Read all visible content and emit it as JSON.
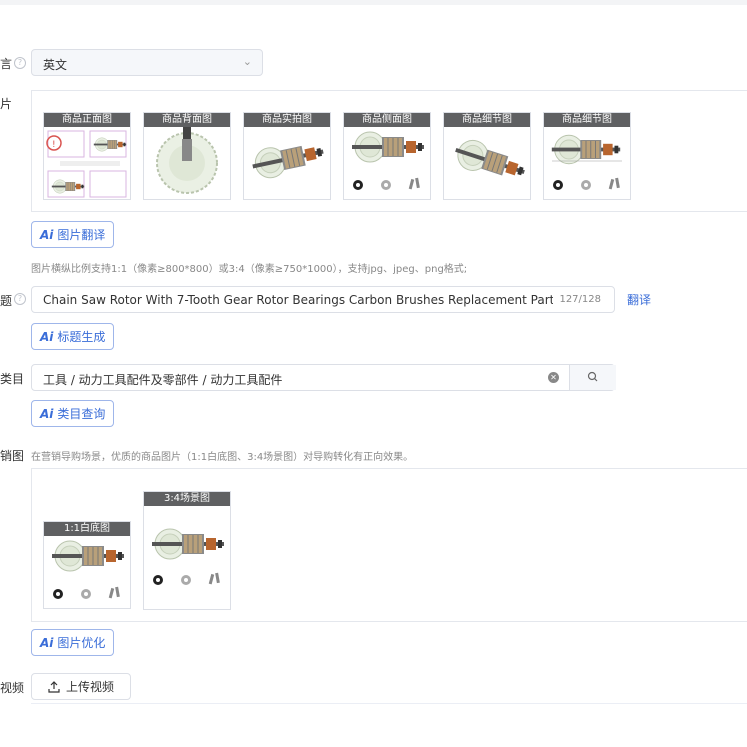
{
  "labels": {
    "language": "言",
    "images": "片",
    "title": "题",
    "category": "类目",
    "marketing": "销图",
    "video": "视频"
  },
  "language_select": {
    "value": "英文"
  },
  "product_images": [
    {
      "caption": "商品正面图"
    },
    {
      "caption": "商品背面图"
    },
    {
      "caption": "商品实拍图"
    },
    {
      "caption": "商品侧面图"
    },
    {
      "caption": "商品细节图"
    },
    {
      "caption": "商品细节图"
    }
  ],
  "buttons": {
    "image_translate": "图片翻译",
    "title_generate": "标题生成",
    "category_query": "类目查询",
    "image_optimize": "图片优化",
    "upload_video": "上传视频",
    "ai": "Ai"
  },
  "images_hint": "图片横纵比例支持1:1（像素≥800*800）或3:4（像素≥750*1000），支持jpg、jpeg、png格式;",
  "title_input": {
    "value": "Chain Saw Rotor With 7-Tooth Gear Rotor Bearings Carbon Brushes Replacement Part For Fo",
    "count": "127/128"
  },
  "translate_link": "翻译",
  "category_input": {
    "value": "工具 / 动力工具配件及零部件 / 动力工具配件"
  },
  "marketing_hint": "在营销导购场景，优质的商品图片（1:1白底图、3:4场景图）对导购转化有正向效果。",
  "marketing_images": [
    {
      "caption": "1:1白底图"
    },
    {
      "caption": "3:4场景图"
    }
  ],
  "colors": {
    "accent": "#3a6dd8",
    "caption_bg": "#5f6062",
    "border": "#dcdfe6"
  }
}
